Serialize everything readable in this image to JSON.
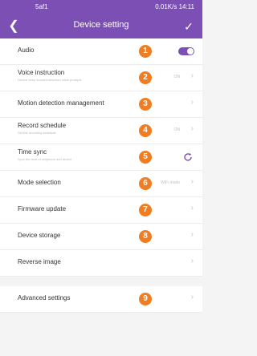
{
  "status": {
    "left": "5af1",
    "right": "0.01K/s 14:11"
  },
  "header": {
    "back_icon": "chevron-left-icon",
    "title": "Device setting",
    "done_icon": "check-icon"
  },
  "rows": [
    {
      "label": "Audio",
      "badge": "1",
      "control": "toggle",
      "on": true
    },
    {
      "label": "Voice instruction",
      "sub": "Device beep sound/instruction voice prompts",
      "value": "ON",
      "badge": "2"
    },
    {
      "label": "Motion detection management",
      "badge": "3"
    },
    {
      "label": "Record schedule",
      "sub": "Set the recording schedule",
      "value": "ON",
      "badge": "4"
    },
    {
      "label": "Time sync",
      "sub": "Sync the time of cellphone and device",
      "badge": "5",
      "control": "sync"
    },
    {
      "label": "Mode selection",
      "value": "WiFi mode",
      "badge": "6"
    },
    {
      "label": "Firmware update",
      "badge": "7"
    },
    {
      "label": "Device storage",
      "badge": "8"
    },
    {
      "label": "Reverse image"
    },
    {
      "label": "Advanced settings",
      "badge": "9"
    }
  ],
  "colors": {
    "accent": "#7b4fb4",
    "badge": "#f07d21"
  }
}
